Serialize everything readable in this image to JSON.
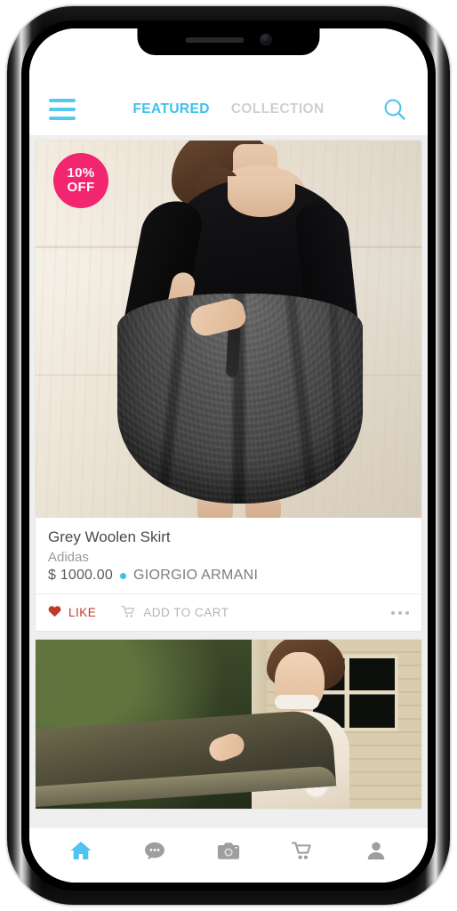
{
  "device": {
    "name": "smartphone-mockup",
    "notch": {
      "speaker": "speaker-grille",
      "camera": "front-camera"
    }
  },
  "header": {
    "menu_icon": "hamburger-menu-icon",
    "search_icon": "search-icon",
    "tabs": [
      {
        "label": "FEATURED",
        "active": true
      },
      {
        "label": "COLLECTION",
        "active": false
      }
    ]
  },
  "colors": {
    "accent_blue": "#3ec0ee",
    "badge_pink": "#f2256f",
    "like_red": "#c0392b",
    "muted_gray": "#b5b5b5",
    "inactive_tab": "#cfcfcf"
  },
  "feed": {
    "cards": [
      {
        "badge": {
          "line1": "10%",
          "line2": "OFF"
        },
        "image_alt": "woman-in-black-top-and-grey-woolen-skirt",
        "title": "Grey Woolen Skirt",
        "brand": "Adidas",
        "price": "$ 1000.00",
        "designer": "GIORGIO ARMANI",
        "actions": {
          "like_label": "LIKE",
          "like_icon": "heart-icon",
          "cart_label": "ADD TO CART",
          "cart_icon": "shopping-cart-icon",
          "more_icon": "more-options-icon"
        }
      },
      {
        "image_alt": "woman-in-white-lace-dress-on-balcony"
      }
    ]
  },
  "bottom_nav": {
    "items": [
      {
        "icon": "home-icon",
        "active": true
      },
      {
        "icon": "chat-bubble-icon",
        "active": false
      },
      {
        "icon": "camera-icon",
        "active": false
      },
      {
        "icon": "shopping-cart-icon",
        "active": false
      },
      {
        "icon": "profile-icon",
        "active": false
      }
    ]
  }
}
